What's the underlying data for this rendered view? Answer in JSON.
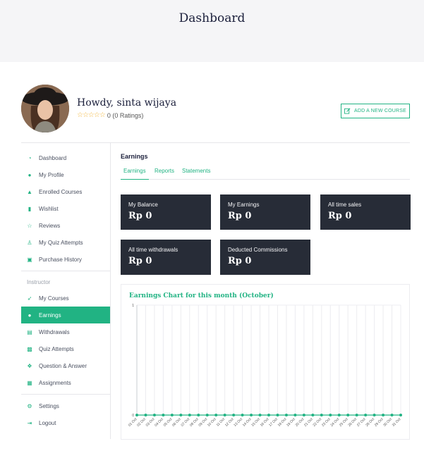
{
  "header": {
    "title": "Dashboard"
  },
  "profile": {
    "greeting": "Howdy, sinta wijaya",
    "stars": "☆☆☆☆☆",
    "rating_text": "0 (0 Ratings)",
    "add_course_label": "ADD A NEW COURSE"
  },
  "sidebar": {
    "items": [
      {
        "label": "Dashboard",
        "icon": "dashboard-icon"
      },
      {
        "label": "My Profile",
        "icon": "user-icon"
      },
      {
        "label": "Enrolled Courses",
        "icon": "graduation-cap-icon"
      },
      {
        "label": "Wishlist",
        "icon": "bookmark-icon"
      },
      {
        "label": "Reviews",
        "icon": "star-icon"
      },
      {
        "label": "My Quiz Attempts",
        "icon": "quiz-icon"
      },
      {
        "label": "Purchase History",
        "icon": "cart-icon"
      }
    ],
    "instructor_heading": "Instructor",
    "instructor_items": [
      {
        "label": "My Courses",
        "icon": "rocket-icon"
      },
      {
        "label": "Earnings",
        "icon": "coin-icon",
        "active": true
      },
      {
        "label": "Withdrawals",
        "icon": "wallet-icon"
      },
      {
        "label": "Quiz Attempts",
        "icon": "quiz-check-icon"
      },
      {
        "label": "Question & Answer",
        "icon": "question-icon"
      },
      {
        "label": "Assignments",
        "icon": "assignment-icon"
      }
    ],
    "bottom_items": [
      {
        "label": "Settings",
        "icon": "gear-icon"
      },
      {
        "label": "Logout",
        "icon": "logout-icon"
      }
    ]
  },
  "main": {
    "title": "Earnings",
    "tabs": [
      "Earnings",
      "Reports",
      "Statements"
    ],
    "cards": [
      {
        "label": "My Balance",
        "value": "Rp 0"
      },
      {
        "label": "My Earnings",
        "value": "Rp 0"
      },
      {
        "label": "All time sales",
        "value": "Rp 0"
      },
      {
        "label": "All time withdrawals",
        "value": "Rp 0"
      },
      {
        "label": "Deducted Commissions",
        "value": "Rp 0"
      }
    ]
  },
  "colors": {
    "accent": "#21b383",
    "card_bg": "#272c37",
    "hero_bg": "#f5f5f7"
  },
  "chart_data": {
    "type": "line",
    "title": "Earnings Chart for this month (October)",
    "categories": [
      "01 Oct",
      "02 Oct",
      "03 Oct",
      "04 Oct",
      "05 Oct",
      "06 Oct",
      "07 Oct",
      "08 Oct",
      "09 Oct",
      "10 Oct",
      "11 Oct",
      "12 Oct",
      "13 Oct",
      "14 Oct",
      "15 Oct",
      "16 Oct",
      "17 Oct",
      "18 Oct",
      "19 Oct",
      "20 Oct",
      "21 Oct",
      "22 Oct",
      "23 Oct",
      "24 Oct",
      "25 Oct",
      "26 Oct",
      "27 Oct",
      "28 Oct",
      "29 Oct",
      "30 Oct",
      "31 Oct"
    ],
    "values": [
      0,
      0,
      0,
      0,
      0,
      0,
      0,
      0,
      0,
      0,
      0,
      0,
      0,
      0,
      0,
      0,
      0,
      0,
      0,
      0,
      0,
      0,
      0,
      0,
      0,
      0,
      0,
      0,
      0,
      0,
      0
    ],
    "ylim": [
      0,
      1
    ],
    "yticks": [
      "0",
      "1"
    ],
    "grid": true
  }
}
